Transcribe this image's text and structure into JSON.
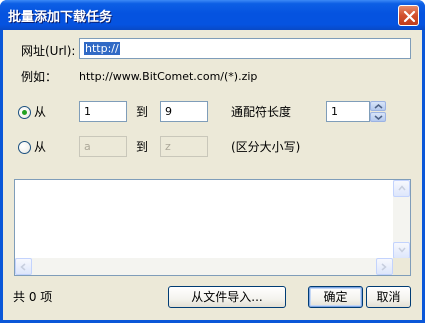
{
  "window": {
    "title": "批量添加下载任务"
  },
  "url_row": {
    "label": "网址(Url):",
    "value": "http://"
  },
  "example_row": {
    "label": "例如：",
    "value": "http://www.BitComet.com/(*).zip"
  },
  "numeric_range": {
    "radio_label": "从",
    "selected": true,
    "from_value": "1",
    "to_label": "到",
    "to_value": "9",
    "wildcard_length_label": "通配符长度",
    "wildcard_length_value": "1"
  },
  "letter_range": {
    "radio_label": "从",
    "selected": false,
    "from_value": "a",
    "to_label": "到",
    "to_value": "z",
    "note": "(区分大小写)"
  },
  "footer": {
    "count_label": "共 0 项",
    "import_button": "从文件导入...",
    "ok_button": "确定",
    "cancel_button": "取消"
  },
  "colors": {
    "titlebar": "#0553e0",
    "client": "#ece9d8",
    "radio_dot": "#21a121",
    "selection": "#316ac5"
  }
}
